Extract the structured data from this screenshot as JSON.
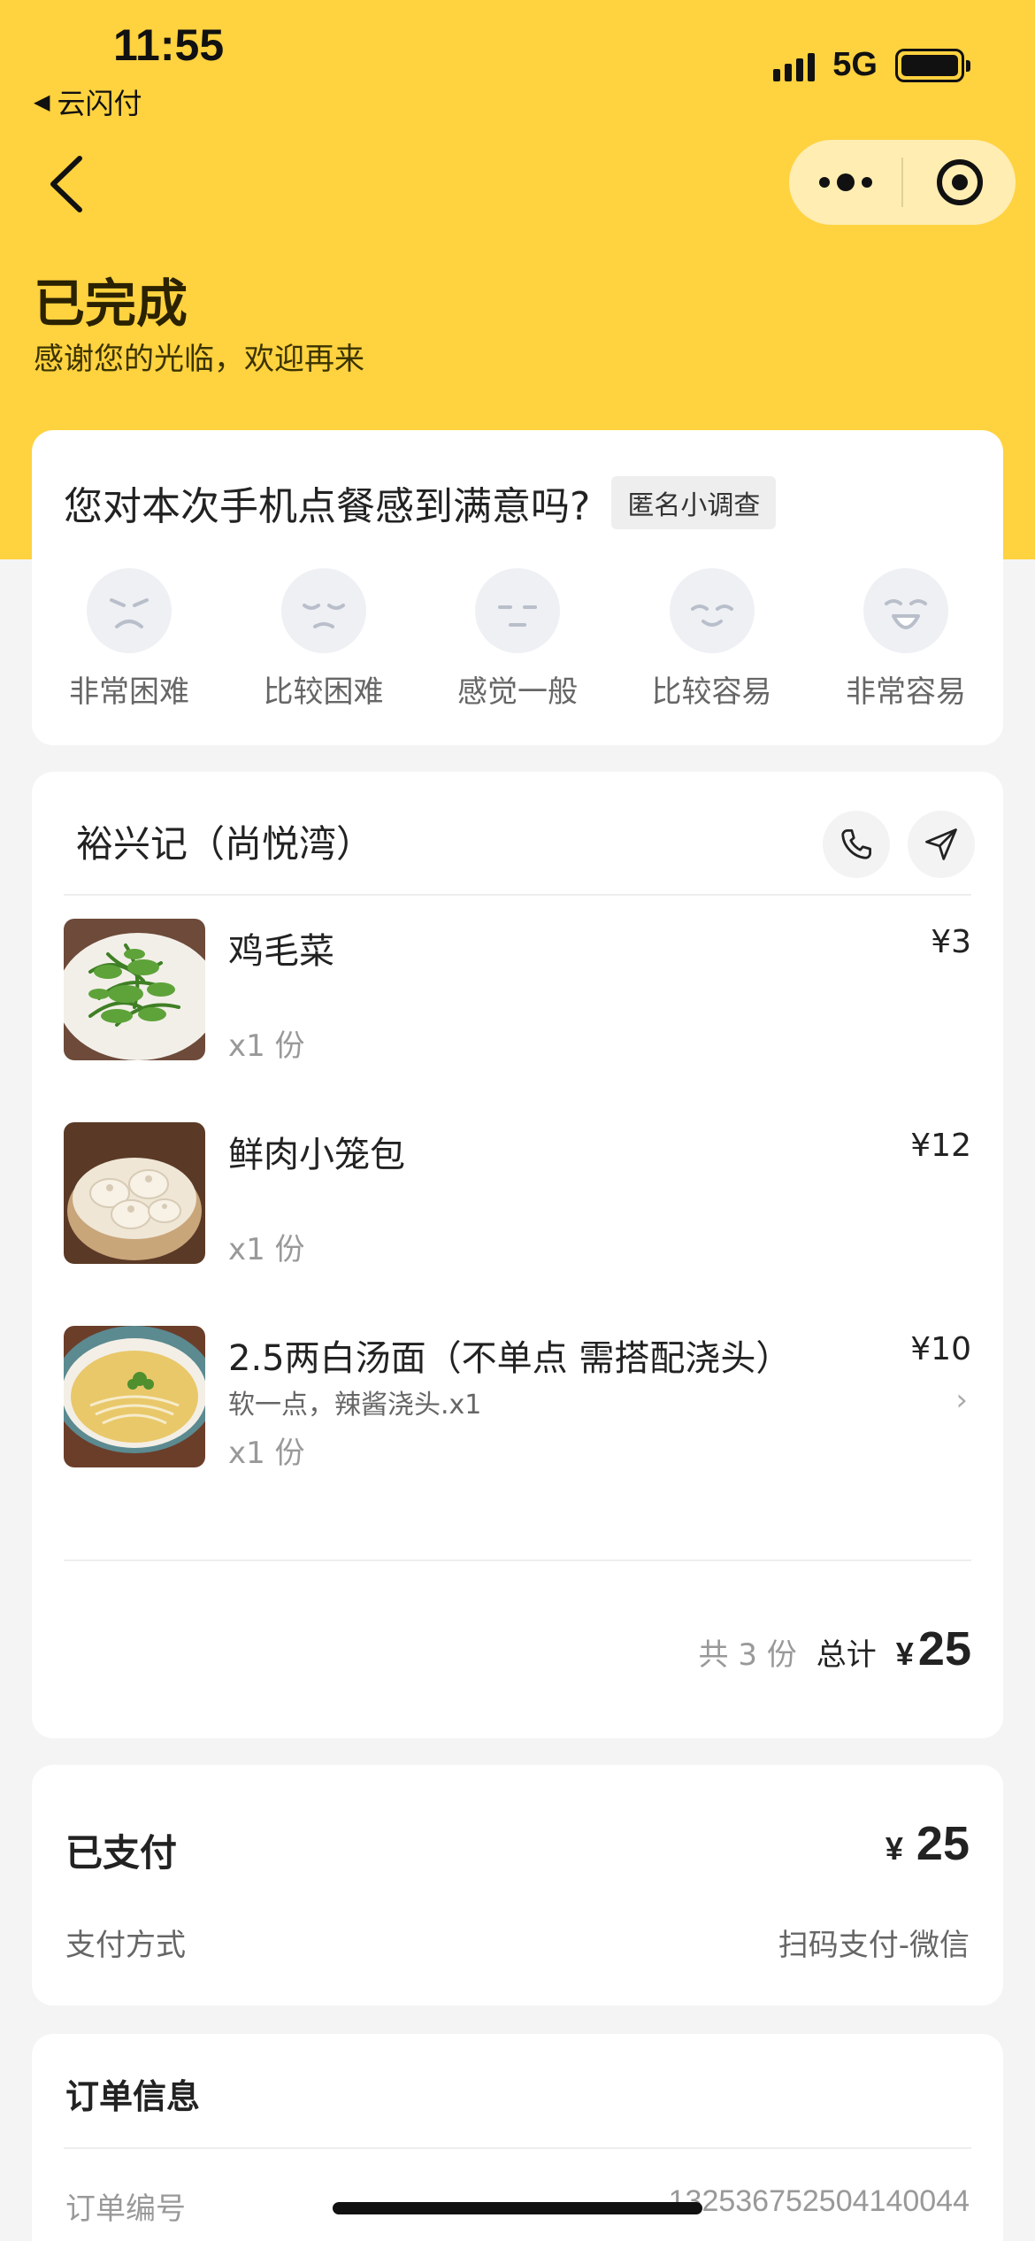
{
  "status_bar": {
    "time": "11:55",
    "back_app": "云闪付",
    "network": "5G"
  },
  "header": {
    "title": "已完成",
    "subtitle": "感谢您的光临，欢迎再来"
  },
  "survey": {
    "question": "您对本次手机点餐感到满意吗?",
    "tag": "匿名小调查",
    "options": [
      {
        "label": "非常困难",
        "icon": "very-hard-face-icon"
      },
      {
        "label": "比较困难",
        "icon": "hard-face-icon"
      },
      {
        "label": "感觉一般",
        "icon": "neutral-face-icon"
      },
      {
        "label": "比较容易",
        "icon": "easy-face-icon"
      },
      {
        "label": "非常容易",
        "icon": "very-easy-face-icon"
      }
    ]
  },
  "order": {
    "shop_name": "裕兴记（尚悦湾）",
    "items": [
      {
        "name": "鸡毛菜",
        "price": "¥3",
        "qty": "x1 份",
        "note": ""
      },
      {
        "name": "鲜肉小笼包",
        "price": "¥12",
        "qty": "x1 份",
        "note": ""
      },
      {
        "name": "2.5两白汤面（不单点 需搭配浇头）",
        "price": "¥10",
        "qty": "x1 份",
        "note": "软一点，辣酱浇头.x1"
      }
    ],
    "count_text": "共 3 份",
    "total_label": "总计",
    "currency": "¥",
    "total": "25"
  },
  "payment": {
    "title": "已支付",
    "currency": "¥",
    "amount": "25",
    "method_label": "支付方式",
    "method_value": "扫码支付-微信"
  },
  "order_info": {
    "title": "订单信息",
    "number_label": "订单编号",
    "number_value": "132536752504140044"
  },
  "colors": {
    "brand_yellow": "#ffd23f",
    "background": "#f4f4f4"
  }
}
